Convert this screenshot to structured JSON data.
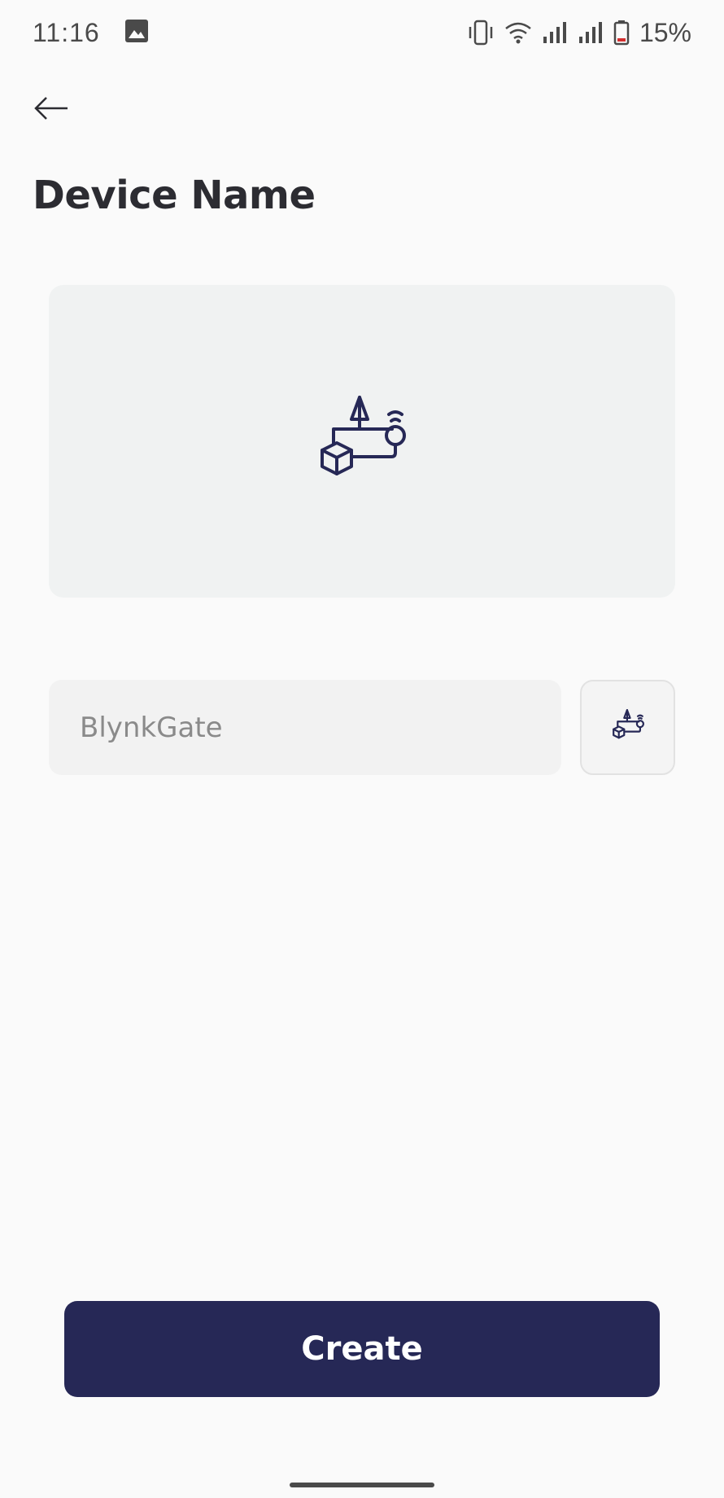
{
  "status_bar": {
    "time": "11:16",
    "battery_percent": "15%",
    "icons": [
      "gallery-icon",
      "vibrate-icon",
      "wifi-icon",
      "signal-icon",
      "signal-icon",
      "battery-icon"
    ]
  },
  "header": {
    "back_icon": "arrow-left-icon",
    "title": "Device Name"
  },
  "device_image": {
    "icon": "device-template-icon"
  },
  "name_field": {
    "placeholder": "BlynkGate",
    "value": ""
  },
  "icon_picker": {
    "icon": "device-template-icon"
  },
  "footer": {
    "create_label": "Create"
  },
  "colors": {
    "primary": "#262856",
    "background": "#fafafa",
    "panel": "#f0f2f2",
    "icon": "#262856",
    "battery_low": "#d32f2f"
  }
}
